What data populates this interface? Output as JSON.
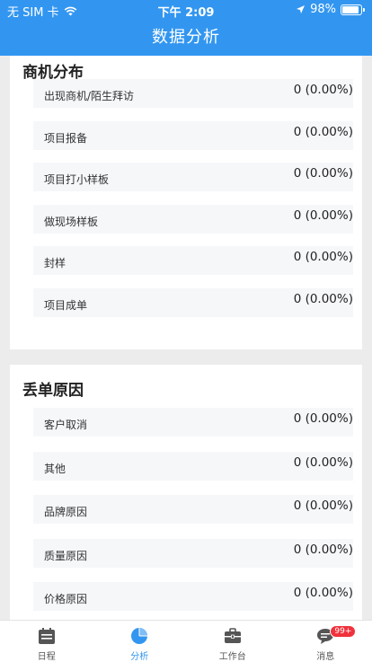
{
  "status_bar": {
    "carrier": "无 SIM 卡",
    "time": "下午 2:09",
    "battery": "98%"
  },
  "header": {
    "title": "数据分析"
  },
  "opportunity": {
    "title": "商机分布",
    "rows": [
      {
        "label": "出现商机/陌生拜访",
        "value": "0 (0.00%)"
      },
      {
        "label": "项目报备",
        "value": "0 (0.00%)"
      },
      {
        "label": "项目打小样板",
        "value": "0 (0.00%)"
      },
      {
        "label": "做现场样板",
        "value": "0 (0.00%)"
      },
      {
        "label": "封样",
        "value": "0 (0.00%)"
      },
      {
        "label": "项目成单",
        "value": "0 (0.00%)"
      }
    ]
  },
  "lost": {
    "title": "丢单原因",
    "rows": [
      {
        "label": "客户取消",
        "value": "0 (0.00%)"
      },
      {
        "label": "其他",
        "value": "0 (0.00%)"
      },
      {
        "label": "品牌原因",
        "value": "0 (0.00%)"
      },
      {
        "label": "质量原因",
        "value": "0 (0.00%)"
      },
      {
        "label": "价格原因",
        "value": "0 (0.00%)"
      }
    ]
  },
  "tabbar": {
    "items": [
      {
        "label": "日程",
        "icon": "calendar-icon"
      },
      {
        "label": "分析",
        "icon": "pie-chart-icon"
      },
      {
        "label": "工作台",
        "icon": "briefcase-icon"
      },
      {
        "label": "消息",
        "icon": "message-icon",
        "badge": "99+"
      }
    ]
  },
  "colors": {
    "primary": "#3296f0",
    "badge": "#f0323c"
  }
}
